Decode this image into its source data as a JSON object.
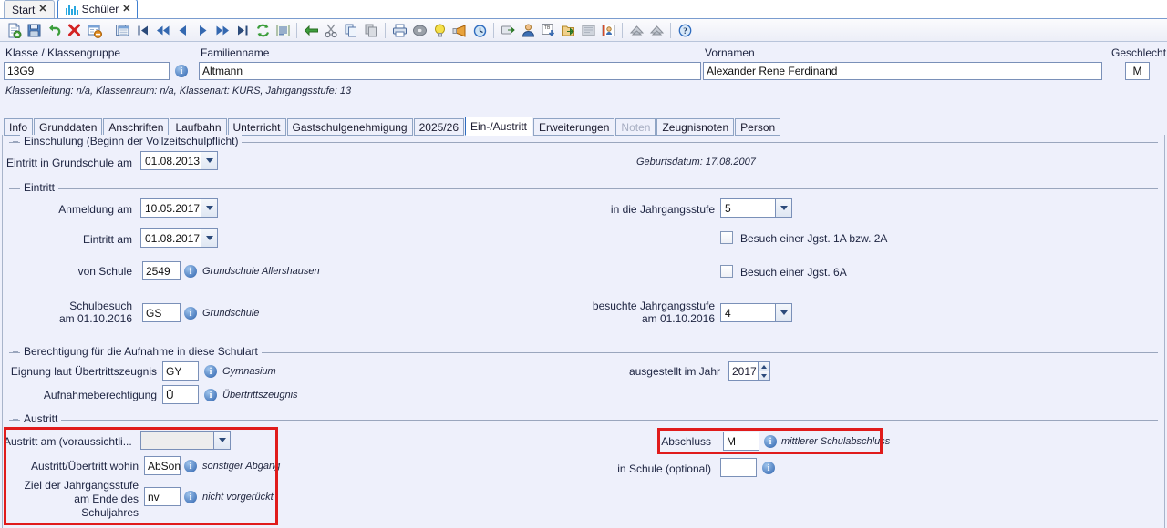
{
  "window": {
    "tabs": [
      {
        "label": "Start",
        "icon": "none",
        "active": false,
        "close": "✕"
      },
      {
        "label": "Schüler",
        "icon": "students-icon",
        "active": true,
        "close": "✕"
      }
    ]
  },
  "toolbar": {
    "groups": [
      [
        "new-icon",
        "save-icon",
        "undo-icon",
        "delete-icon",
        "remove-record-icon"
      ],
      [
        "table-view-icon",
        "first-record-icon",
        "fast-back-icon",
        "prev-record-icon",
        "next-record-icon",
        "fast-forward-icon",
        "last-record-icon",
        "refresh-icon",
        "list-icon"
      ],
      [
        "back-arrow-icon",
        "cut-icon",
        "copy-icon",
        "paste-icon"
      ],
      [
        "print-icon",
        "cd-icon",
        "hint-icon",
        "megaphone-icon",
        "clock-icon"
      ],
      [
        "export-icon",
        "user-icon",
        "tb-download-icon",
        "folder-export-icon",
        "note-icon",
        "id-card-icon"
      ],
      [
        "merge-up-icon",
        "merge-down-icon"
      ],
      [
        "help-icon"
      ]
    ]
  },
  "header": {
    "class_label": "Klasse / Klassengruppe",
    "class_value": "13G9",
    "lastname_label": "Familienname",
    "lastname_value": "Altmann",
    "firstname_label": "Vornamen",
    "firstname_value": "Alexander Rene Ferdinand",
    "gender_label": "Geschlecht",
    "gender_value": "M",
    "meta": "Klassenleitung: n/a, Klassenraum: n/a, Klassenart: KURS, Jahrgangsstufe: 13"
  },
  "inner_tabs": [
    {
      "label": "Info",
      "state": "normal"
    },
    {
      "label": "Grunddaten",
      "state": "normal"
    },
    {
      "label": "Anschriften",
      "state": "normal"
    },
    {
      "label": "Laufbahn",
      "state": "normal"
    },
    {
      "label": "Unterricht",
      "state": "normal"
    },
    {
      "label": "Gastschulgenehmigung",
      "state": "normal"
    },
    {
      "label": "2025/26",
      "state": "normal"
    },
    {
      "label": "Ein-/Austritt",
      "state": "active"
    },
    {
      "label": "Erweiterungen",
      "state": "normal"
    },
    {
      "label": "Noten",
      "state": "disabled"
    },
    {
      "label": "Zeugnisnoten",
      "state": "normal"
    },
    {
      "label": "Person",
      "state": "normal"
    }
  ],
  "einschulung": {
    "title": "Einschulung (Beginn der Vollzeitschulpflicht)",
    "entry_label": "Eintritt in Grundschule am",
    "entry_value": "01.08.2013",
    "birthdate": "Geburtsdatum: 17.08.2007"
  },
  "eintritt": {
    "title": "Eintritt",
    "anmeldung_label": "Anmeldung am",
    "anmeldung_value": "10.05.2017",
    "eintritt_label": "Eintritt am",
    "eintritt_value": "01.08.2017",
    "vonschule_label": "von Schule",
    "vonschule_value": "2549",
    "vonschule_note": "Grundschule Allershausen",
    "schulbesuch_label_1": "Schulbesuch",
    "schulbesuch_label_2": "am 01.10.2016",
    "schulbesuch_value": "GS",
    "schulbesuch_note": "Grundschule",
    "jgst_label": "in die Jahrgangsstufe",
    "jgst_value": "5",
    "cb1_label": "Besuch einer Jgst. 1A bzw. 2A",
    "cb1_checked": false,
    "cb2_label": "Besuch einer Jgst. 6A",
    "cb2_checked": false,
    "besuchte_label_1": "besuchte Jahrgangsstufe",
    "besuchte_label_2": "am 01.10.2016",
    "besuchte_value": "4"
  },
  "berechtigung": {
    "title": "Berechtigung für die Aufnahme in diese Schulart",
    "eignung_label": "Eignung laut Übertrittszeugnis",
    "eignung_value": "GY",
    "eignung_note": "Gymnasium",
    "aufnahme_label": "Aufnahmeberechtigung",
    "aufnahme_value": "Ü",
    "aufnahme_note": "Übertrittszeugnis",
    "jahr_label": "ausgestellt im Jahr",
    "jahr_value": "2017"
  },
  "austritt": {
    "title": "Austritt",
    "austritt_am_label": "Austritt am (voraussichtli...",
    "austritt_am_value": "",
    "wohin_label": "Austritt/Übertritt wohin",
    "wohin_value": "AbSon",
    "wohin_note": "sonstiger Abgang",
    "ziel_label_1": "Ziel der Jahrgangsstufe",
    "ziel_label_2": "am Ende des",
    "ziel_label_3": "Schuljahres",
    "ziel_value": "nv",
    "ziel_note": "nicht vorgerückt",
    "abschluss_label": "Abschluss",
    "abschluss_value": "M",
    "abschluss_note": "mittlerer Schulabschluss",
    "inschule_label": "in Schule (optional)",
    "inschule_value": ""
  },
  "colors": {
    "highlight": "#e01b1b",
    "background": "#eef0fb",
    "accent": "#2f6cbf"
  }
}
